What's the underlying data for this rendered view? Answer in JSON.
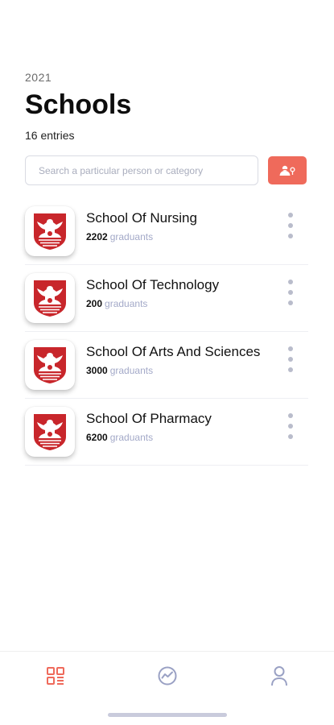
{
  "header": {
    "year": "2021",
    "title": "Schools",
    "entries": "16 entries"
  },
  "search": {
    "placeholder": "Search a particular person or category",
    "value": ""
  },
  "colors": {
    "accent": "#ef6a5b",
    "logo_red": "#c8262b",
    "muted_text": "#a3a9c8",
    "tab_inactive": "#9aa1c4"
  },
  "icons": {
    "filter_button": "filter-person-icon",
    "school_logo": "phoenix-crest-icon",
    "row_menu": "more-vertical-icon",
    "tabs": [
      "dashboard-grid-icon",
      "analytics-icon",
      "profile-icon"
    ]
  },
  "schools": [
    {
      "name": "School Of Nursing",
      "count": "2202",
      "unit": "graduants"
    },
    {
      "name": "School Of Technology",
      "count": "200",
      "unit": "graduants"
    },
    {
      "name": "School Of Arts And Sciences",
      "count": "3000",
      "unit": "graduants"
    },
    {
      "name": "School Of Pharmacy",
      "count": "6200",
      "unit": "graduants"
    }
  ],
  "tabs": {
    "active_index": 0
  }
}
